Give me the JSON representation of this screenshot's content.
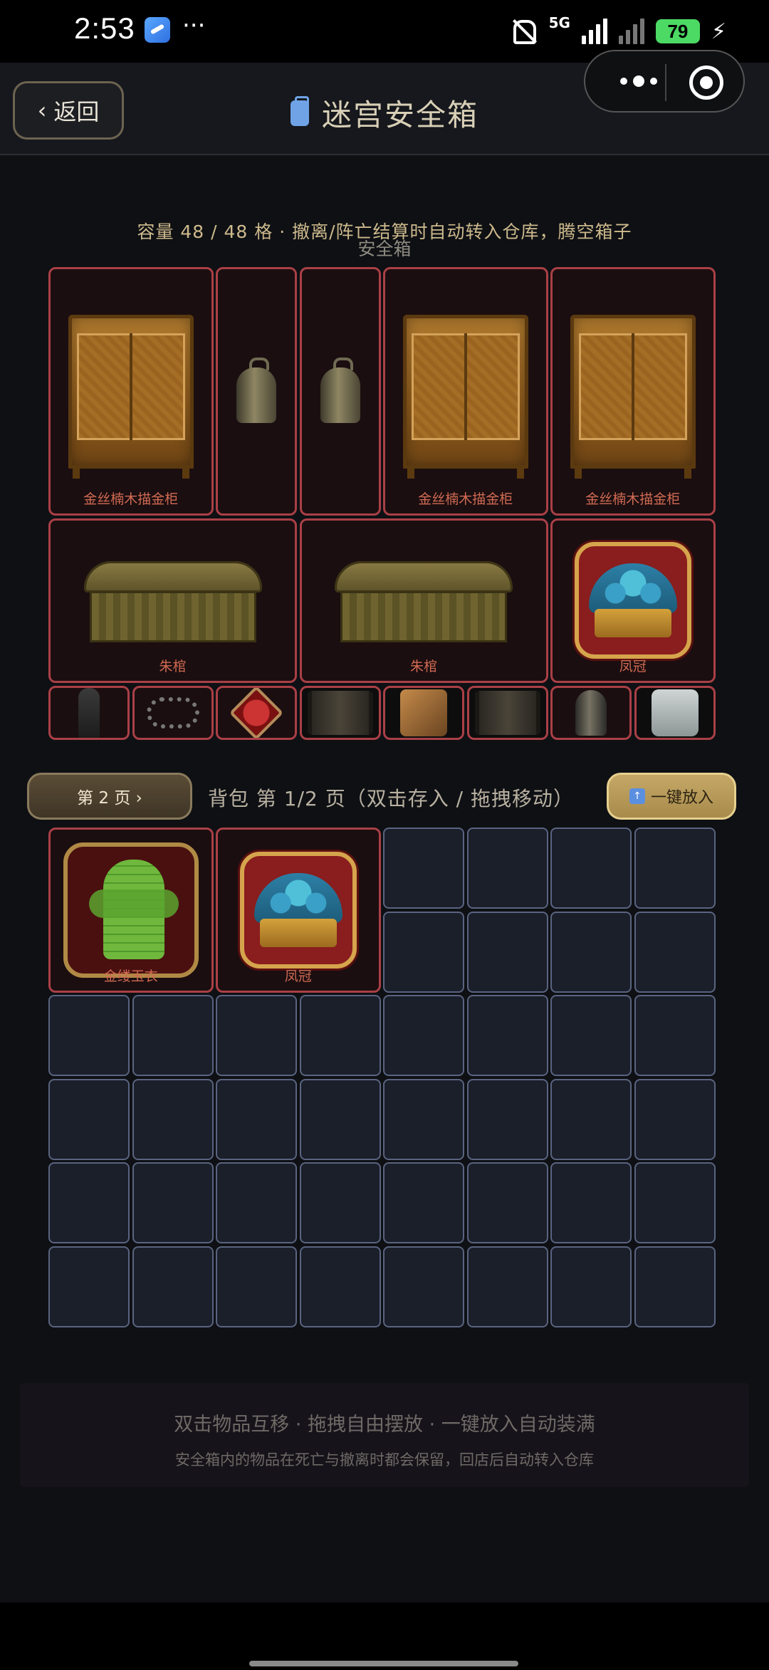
{
  "status_bar": {
    "time": "2:53",
    "more": "···",
    "network": "5G",
    "battery": "79"
  },
  "header": {
    "back_label": "返回",
    "title": "迷宫安全箱"
  },
  "safe": {
    "capacity_text": "容量 48 / 48 格 · 撤离/阵亡结算时自动转入仓库，腾空箱子",
    "label": "安全箱",
    "items": {
      "cabinet": "金丝楠木描金柜",
      "coffin": "朱棺",
      "crown": "凤冠"
    }
  },
  "toolbar": {
    "page_button": "第 2 页 ›",
    "bag_label": "背包 第 1/2 页（双击存入 / 拖拽移动）",
    "fill_button": "一键放入"
  },
  "bag": {
    "items": {
      "armor": "金缕玉衣",
      "crown": "凤冠"
    }
  },
  "tips": {
    "line1": "双击物品互移 · 拖拽自由摆放 · 一键放入自动装满",
    "line2": "安全箱内的物品在死亡与撤离时都会保留，回店后自动转入仓库"
  },
  "colors": {
    "accent_gold": "#c5a866",
    "item_border_red": "#a94046",
    "slot_border": "#5a6480"
  }
}
